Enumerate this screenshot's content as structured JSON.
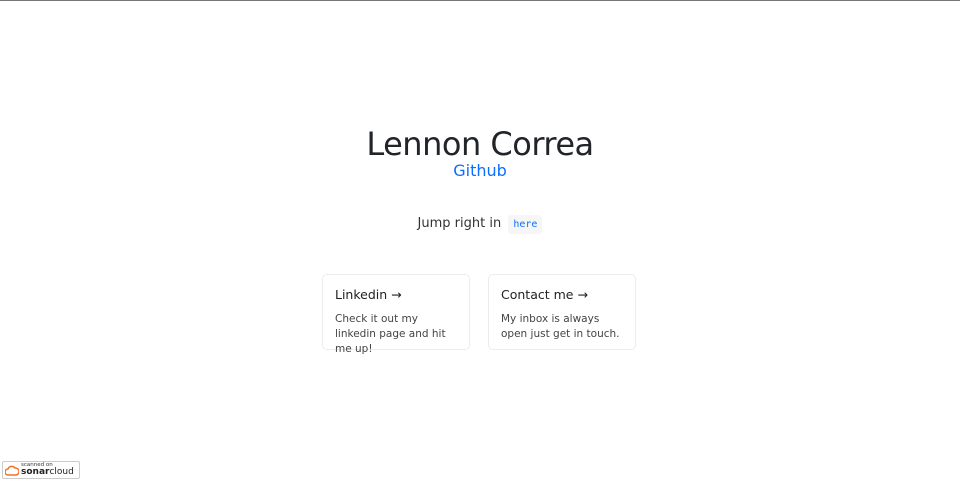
{
  "header": {
    "name": "Lennon Correa",
    "github_label": "Github"
  },
  "intro": {
    "text": "Jump right in",
    "link_label": "here"
  },
  "cards": [
    {
      "title": "Linkedin →",
      "description": "Check it out my linkedin page and hit me up!"
    },
    {
      "title": "Contact me →",
      "description": "My inbox is always open just get in touch."
    }
  ],
  "badge": {
    "line1": "scanned on",
    "brand_bold": "sonar",
    "brand_light": "cloud",
    "accent": "#f3702a"
  },
  "colors": {
    "link": "#0d6efd",
    "text": "#212529"
  }
}
